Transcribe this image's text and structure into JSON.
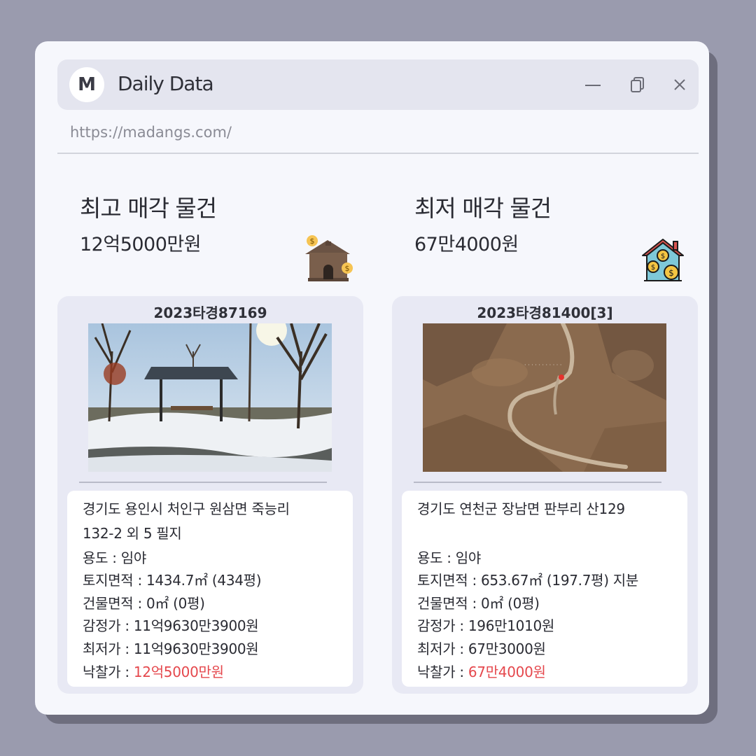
{
  "window": {
    "logo_letter": "M",
    "title": "Daily Data",
    "url": "https://madangs.com/"
  },
  "left": {
    "heading": "최고 매각 물건",
    "price": "12억5000만원",
    "case_no": "2023타경87169",
    "address_line1": "경기도 용인시 처인구 원삼면 죽능리",
    "address_line2": "132-2 외 5 필지",
    "usage": "용도 : 임야",
    "land_area": "토지면적 : 1434.7㎡ (434평)",
    "building_area": "건물면적 : 0㎡ (0평)",
    "appraisal": "감정가 : 11억9630만3900원",
    "minimum": "최저가 : 11억9630만3900원",
    "winning_label": "낙찰가 : ",
    "winning_value": "12억5000만원"
  },
  "right": {
    "heading": "최저 매각 물건",
    "price": "67만4000원",
    "case_no": "2023타경81400[3]",
    "address_line1": "경기도 연천군 장남면 판부리 산129",
    "address_line2": "",
    "usage": "용도 : 임야",
    "land_area": "토지면적 : 653.67㎡ (197.7평) 지분",
    "building_area": "건물면적 : 0㎡ (0평)",
    "appraisal": "감정가 : 196만1010원",
    "minimum": "최저가 : 67만3000원",
    "winning_label": "낙찰가 : ",
    "winning_value": "67만4000원"
  },
  "colors": {
    "background": "#9a9bae",
    "window": "#f6f7fc",
    "titlebar": "#e4e5ef",
    "card": "#e8e9f4",
    "accent_red": "#e5484d"
  },
  "icons": {
    "minimize": "minimize-icon",
    "restore": "restore-icon",
    "close": "close-icon",
    "left_deco": "money-house-icon",
    "right_deco": "house-coins-icon"
  }
}
